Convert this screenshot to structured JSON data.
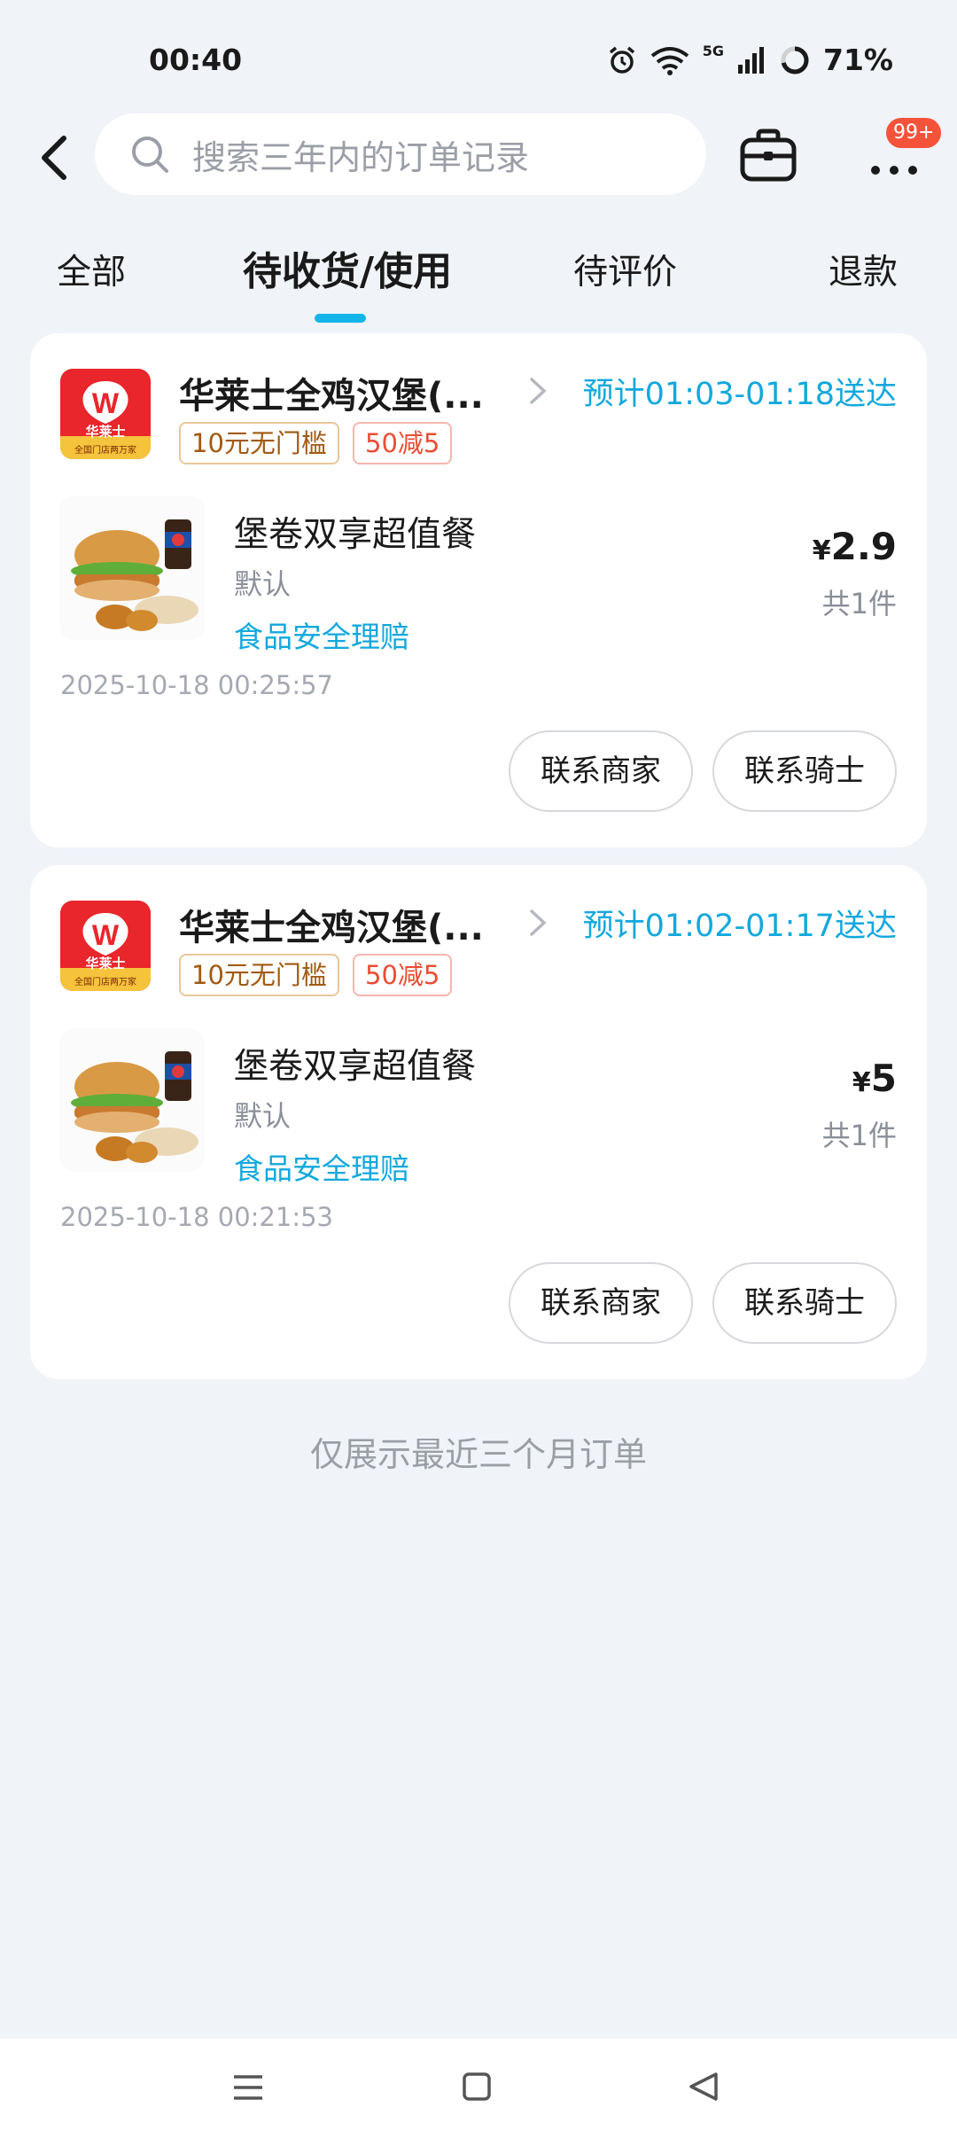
{
  "status_bar": {
    "time": "00:40",
    "battery": "71%",
    "network": "5G"
  },
  "search": {
    "placeholder": "搜索三年内的订单记录"
  },
  "header": {
    "more_badge": "99+"
  },
  "tabs": [
    {
      "label": "全部",
      "active": false
    },
    {
      "label": "待收货/使用",
      "active": true
    },
    {
      "label": "待评价",
      "active": false
    },
    {
      "label": "退款",
      "active": false
    }
  ],
  "orders": [
    {
      "shop_name": "华莱士全鸡汉堡(...",
      "logo_text": "华莱士",
      "logo_sub": "全国门店两万家",
      "eta": "预计01:03-01:18送达",
      "promos": [
        "10元无门槛",
        "50减5"
      ],
      "item_name": "堡卷双享超值餐",
      "item_spec": "默认",
      "item_link": "食品安全理赔",
      "currency": "¥",
      "price": "2.9",
      "count": "共1件",
      "order_time": "2025-10-18 00:25:57",
      "buttons": {
        "merchant": "联系商家",
        "rider": "联系骑士"
      }
    },
    {
      "shop_name": "华莱士全鸡汉堡(...",
      "logo_text": "华莱士",
      "logo_sub": "全国门店两万家",
      "eta": "预计01:02-01:17送达",
      "promos": [
        "10元无门槛",
        "50减5"
      ],
      "item_name": "堡卷双享超值餐",
      "item_spec": "默认",
      "item_link": "食品安全理赔",
      "currency": "¥",
      "price": "5",
      "count": "共1件",
      "order_time": "2025-10-18 00:21:53",
      "buttons": {
        "merchant": "联系商家",
        "rider": "联系骑士"
      }
    }
  ],
  "footer_note": "仅展示最近三个月订单",
  "colors": {
    "accent": "#13a8dd",
    "background": "#f0f3f8",
    "badge": "#f5523a",
    "promo_brown": "#a15a12",
    "promo_red": "#e94d35"
  },
  "icons": [
    "back-arrow-icon",
    "search-icon",
    "briefcase-icon",
    "more-dots-icon",
    "chevron-right-icon",
    "menu-icon",
    "home-square-icon",
    "back-triangle-icon"
  ]
}
